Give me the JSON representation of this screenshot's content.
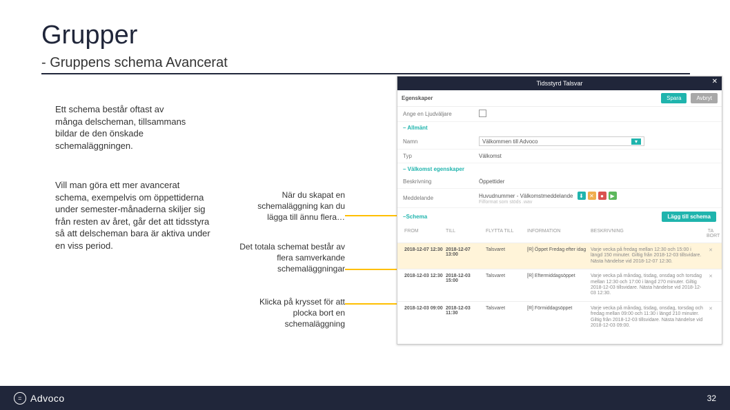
{
  "title": "Grupper",
  "subtitle": "- Gruppens schema Avancerat",
  "body1": "Ett schema består oftast av många delscheman, tillsammans bildar de den önskade schemaläggningen.",
  "body2": "Vill man göra ett mer avancerat schema, exempelvis om öppettiderna under semester-månaderna skiljer sig från resten av året, går det att tidsstyra så att delscheman bara är aktiva under en viss period.",
  "annot1": "När du skapat en schemaläggning kan du lägga till ännu flera…",
  "annot2": "Det totala schemat består av flera samverkande schemaläggningar",
  "annot3": "Klicka på krysset för att plocka bort en schemaläggning",
  "modal": {
    "title": "Tidsstyrd Talsvar",
    "close": "✕",
    "tab": "Egenskaper",
    "save": "Spara",
    "cancel": "Avbryt",
    "fields": {
      "angeLjud": "Ange en Ljudväljare",
      "allmant": "Allmänt",
      "namn": "Namn",
      "namn_val": "Välkommen till Advoco",
      "typ": "Typ",
      "typ_val": "Välkomst",
      "valk": "Välkomst egenskaper",
      "besk": "Beskrivning",
      "besk_val": "Öppettider",
      "medd": "Meddelande",
      "medd_val": "Huvudnummer - Välkomstmeddelande",
      "medd_sub": "Filformat som stöds .wav",
      "schema": "Schema",
      "add": "Lägg till schema"
    },
    "sched_hdr": {
      "c1": "FROM",
      "c2": "TILL",
      "c3": "FLYTTA TILL",
      "c4": "INFORMATION",
      "c5": "BESKRIVNING",
      "c6": "TA BORT"
    },
    "rows": [
      {
        "from": "2018-12-07 12:30",
        "to": "2018-12-07 13:00",
        "mv": "Talsvaret",
        "info": "[R] Öppet Fredag efter idag",
        "desc": "Varje vecka på fredag mellan 12:30 och 15:00 i längd 150 minuter. Giltig från 2018-12-03 tillsvidare. Nästa händelse vid 2018-12-07 12:30.",
        "hl": true
      },
      {
        "from": "2018-12-03 12:30",
        "to": "2018-12-03 15:00",
        "mv": "Talsvaret",
        "info": "[R] Eftermiddagsöppet",
        "desc": "Varje vecka på måndag, tisdag, onsdag och torsdag mellan 12:30 och 17:00 i längd 270 minuter. Giltig 2018-12-03 tillsvidare. Nästa händelse vid 2018-12-03 12:30.",
        "hl": false
      },
      {
        "from": "2018-12-03 09:00",
        "to": "2018-12-03 11:30",
        "mv": "Talsvaret",
        "info": "[R] Förmiddagsöppet",
        "desc": "Varje vecka på måndag, tisdag, onsdag, torsdag och fredag mellan 09:00 och 11:30 i längd 210 minuter. Giltig från 2018-12-03 tillsvidare. Nästa händelse vid 2018-12-03 09:00.",
        "hl": false
      }
    ]
  },
  "footer": {
    "brand": "Advoco",
    "page": "32"
  }
}
